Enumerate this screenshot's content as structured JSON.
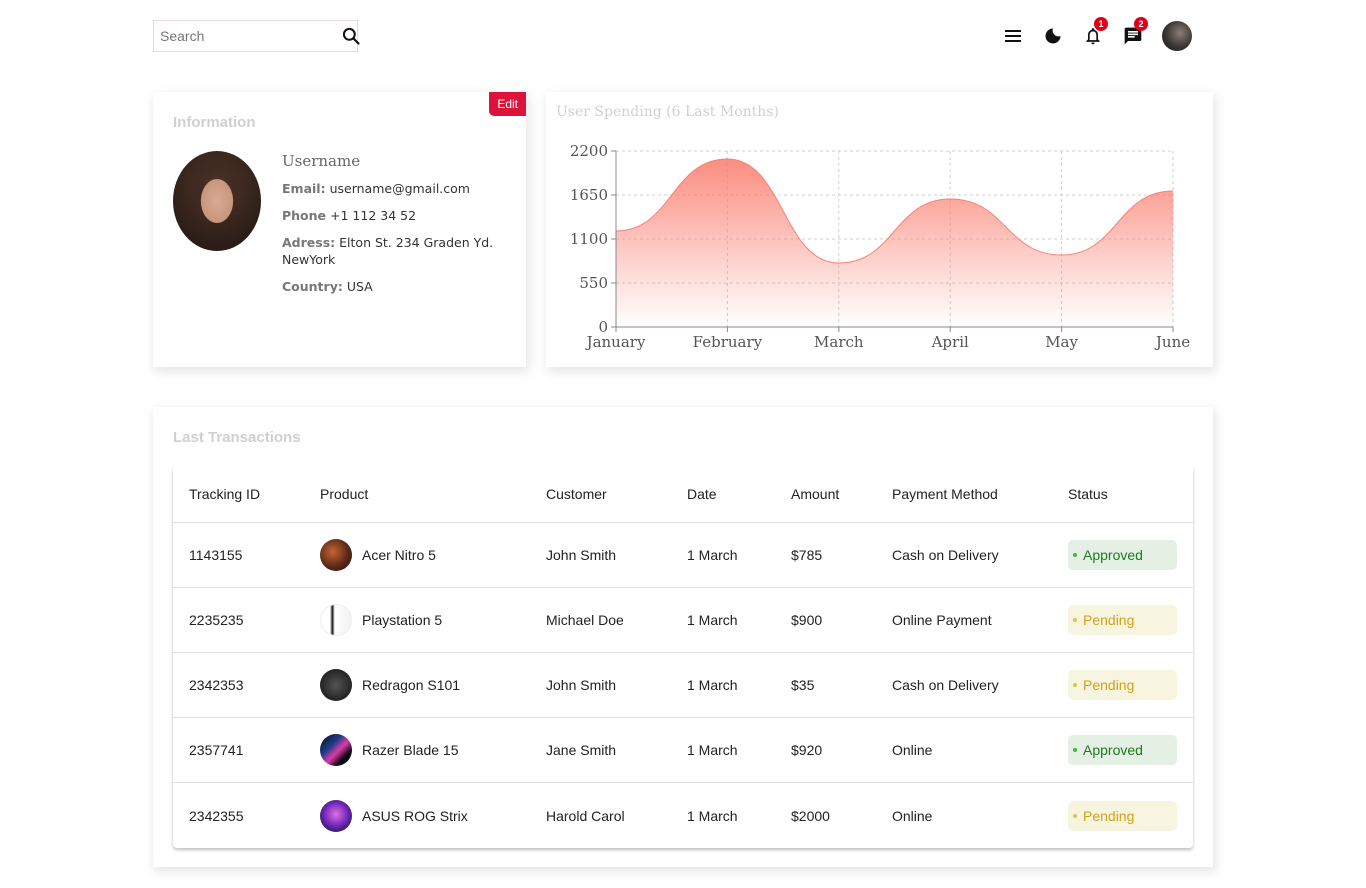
{
  "search": {
    "placeholder": "Search"
  },
  "header": {
    "icons": [
      "menu-icon",
      "moon-icon",
      "bell-icon",
      "chat-icon"
    ],
    "notifications_count": "1",
    "messages_count": "2"
  },
  "info": {
    "title": "Information",
    "edit_label": "Edit",
    "username": "Username",
    "email_label": "Email:",
    "email": "username@gmail.com",
    "phone_label": "Phone",
    "phone": "+1 112 34 52",
    "address_label": "Adress:",
    "address": "Elton St. 234 Graden Yd. NewYork",
    "country_label": "Country:",
    "country": "USA"
  },
  "chart_data": {
    "type": "area",
    "title": "User Spending (6 Last Months)",
    "categories": [
      "January",
      "February",
      "March",
      "April",
      "May",
      "June"
    ],
    "values": [
      1200,
      2100,
      800,
      1600,
      900,
      1700
    ],
    "yticks": [
      0,
      550,
      1100,
      1650,
      2200
    ],
    "ylim": [
      0,
      2200
    ],
    "grid": true,
    "color": "#fa8072"
  },
  "transactions": {
    "title": "Last Transactions",
    "columns": [
      "Tracking ID",
      "Product",
      "Customer",
      "Date",
      "Amount",
      "Payment Method",
      "Status"
    ],
    "rows": [
      {
        "id": "1143155",
        "product": "Acer Nitro 5",
        "customer": "John Smith",
        "date": "1 March",
        "amount": "$785",
        "method": "Cash on Delivery",
        "status": "Approved"
      },
      {
        "id": "2235235",
        "product": "Playstation 5",
        "customer": "Michael Doe",
        "date": "1 March",
        "amount": "$900",
        "method": "Online Payment",
        "status": "Pending"
      },
      {
        "id": "2342353",
        "product": "Redragon S101",
        "customer": "John Smith",
        "date": "1 March",
        "amount": "$35",
        "method": "Cash on Delivery",
        "status": "Pending"
      },
      {
        "id": "2357741",
        "product": "Razer Blade 15",
        "customer": "Jane Smith",
        "date": "1 March",
        "amount": "$920",
        "method": "Online",
        "status": "Approved"
      },
      {
        "id": "2342355",
        "product": "ASUS ROG Strix",
        "customer": "Harold Carol",
        "date": "1 March",
        "amount": "$2000",
        "method": "Online",
        "status": "Pending"
      }
    ]
  }
}
